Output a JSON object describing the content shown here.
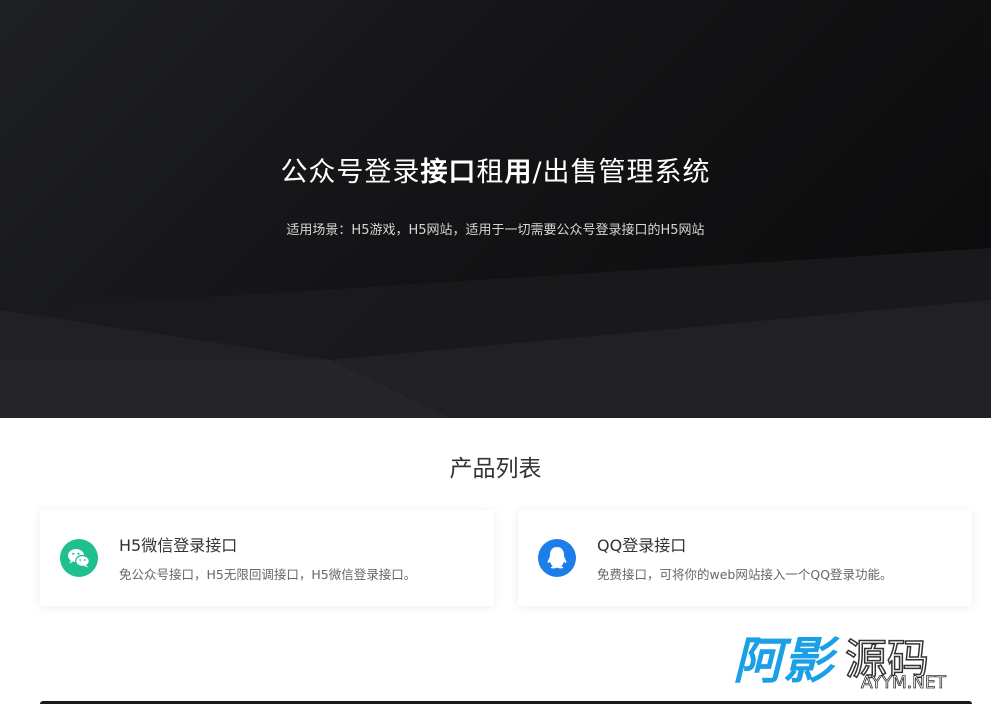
{
  "hero": {
    "title_parts": [
      "公众号登录",
      "接口",
      "租",
      "用",
      "/出售管理系统"
    ],
    "subtitle": "适用场景：H5游戏，H5网站，适用于一切需要公众号登录接口的H5网站"
  },
  "products": {
    "section_title": "产品列表",
    "items": [
      {
        "title": "H5微信登录接口",
        "description": "免公众号接口，H5无限回调接口，H5微信登录接口。",
        "icon": "wechat-icon",
        "icon_color": "#1fc08e"
      },
      {
        "title": "QQ登录接口",
        "description": "免费接口，可将你的web网站接入一个QQ登录功能。",
        "icon": "qq-icon",
        "icon_color": "#1c7ee8"
      }
    ]
  },
  "watermark": {
    "name": "阿影源码",
    "domain": "AYYM.NET",
    "color": "#1aa0e6"
  },
  "colors": {
    "hero_dark": "#0a0a0b",
    "hero_light": "#1f2023",
    "text_primary": "#333333"
  }
}
